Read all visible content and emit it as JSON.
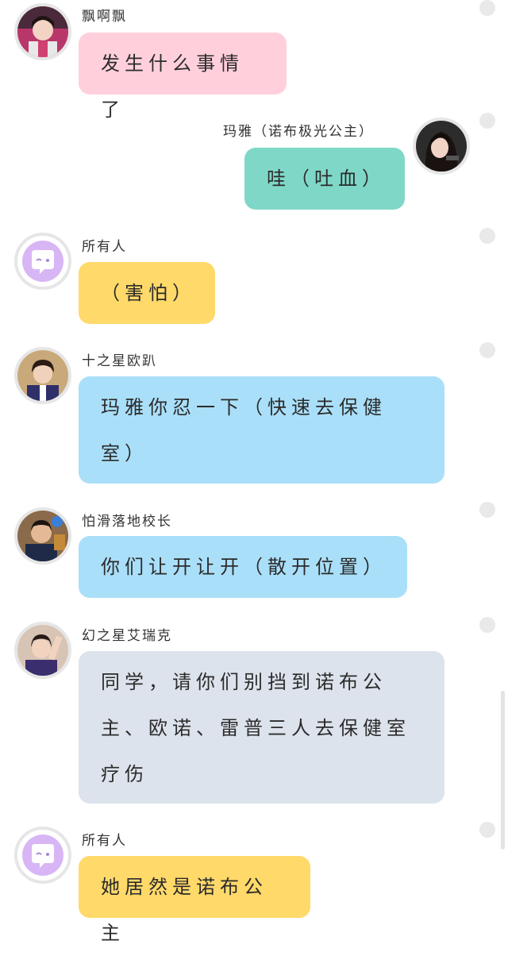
{
  "messages": [
    {
      "sender": "飘啊飘",
      "text": "发生什么事情了",
      "color": "#ffd0dc",
      "side": "left",
      "avatar_icon": "girl-avatar"
    },
    {
      "sender": "玛雅（诺布极光公主）",
      "text": "哇（吐血）",
      "color": "#7fd8c7",
      "side": "right",
      "avatar_icon": "woman-avatar"
    },
    {
      "sender": "所有人",
      "text": "（害怕）",
      "color": "#ffd96a",
      "side": "left",
      "avatar_icon": "chat-bubble-avatar"
    },
    {
      "sender": "十之星欧趴",
      "text": "玛雅你忍一下（快速去保健室）",
      "color": "#aadff9",
      "side": "left",
      "avatar_icon": "boy-avatar"
    },
    {
      "sender": "怕滑落地校长",
      "text": "你们让开让开（散开位置）",
      "color": "#aadff9",
      "side": "left",
      "avatar_icon": "man-avatar"
    },
    {
      "sender": "幻之星艾瑞克",
      "text": "同学，请你们别挡到诺布公主、欧诺、雷普三人去保健室疗伤",
      "color": "#dde3ec",
      "side": "left",
      "avatar_icon": "boy-avatar"
    },
    {
      "sender": "所有人",
      "text": "她居然是诺布公主",
      "color": "#ffd96a",
      "side": "left",
      "avatar_icon": "chat-bubble-avatar"
    }
  ],
  "colors": {
    "avatar_ring": "#e6e6e6",
    "selector": "#e9e9e9",
    "background": "#ffffff"
  }
}
